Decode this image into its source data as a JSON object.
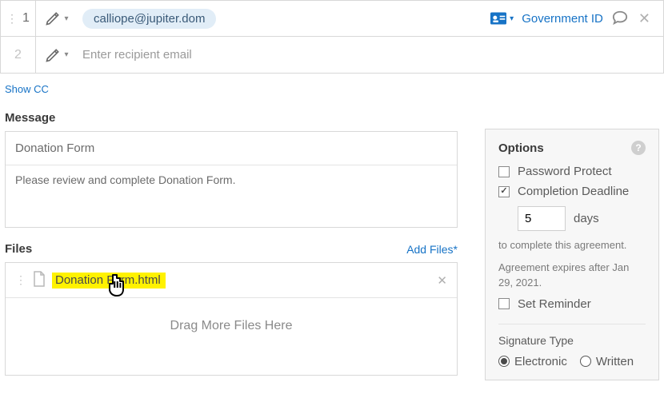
{
  "recipients": [
    {
      "num": "1",
      "chip": "calliope@jupiter.dom",
      "id_label": "Government ID"
    },
    {
      "num": "2",
      "placeholder": "Enter recipient email"
    }
  ],
  "show_cc": "Show CC",
  "message": {
    "heading": "Message",
    "subject": "Donation Form",
    "body": "Please review and complete Donation Form."
  },
  "files": {
    "heading": "Files",
    "add": "Add Files*",
    "filename": "Donation Form.html",
    "dragtext": "Drag More Files Here"
  },
  "options": {
    "heading": "Options",
    "password_protect": "Password Protect",
    "completion_deadline": "Completion Deadline",
    "days_value": "5",
    "days_label": "days",
    "fineprint_1": "to complete this agreement.",
    "fineprint_2": "Agreement expires after Jan 29, 2021.",
    "set_reminder": "Set Reminder",
    "sig_heading": "Signature Type",
    "sig_electronic": "Electronic",
    "sig_written": "Written"
  }
}
